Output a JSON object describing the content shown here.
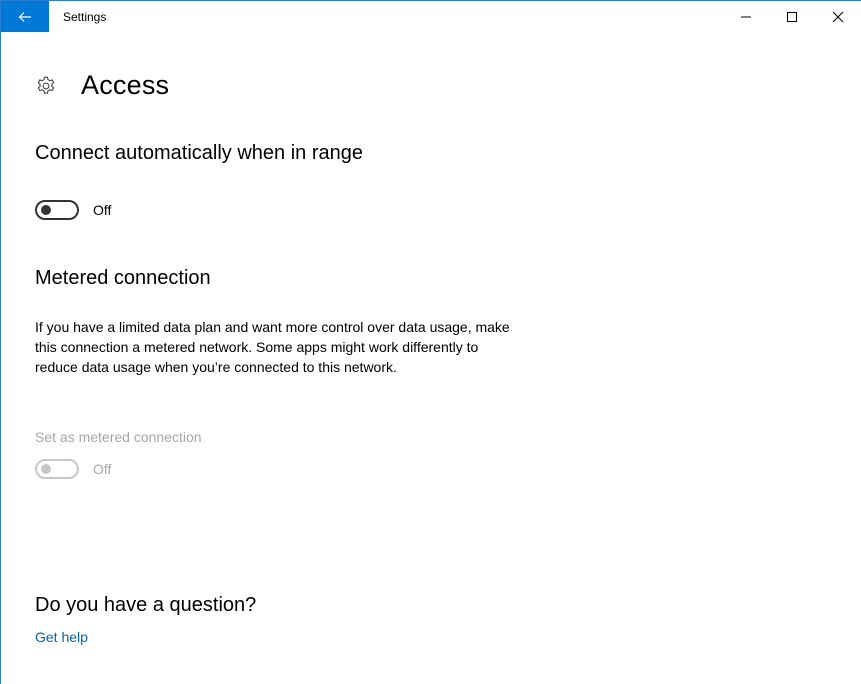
{
  "window": {
    "app_title": "Settings",
    "accent_color": "#0078d7",
    "controls": {
      "minimize_icon": "minimize-icon",
      "maximize_icon": "maximize-icon",
      "close_icon": "close-icon"
    }
  },
  "page": {
    "title": "Access",
    "icon": "gear-icon"
  },
  "connect_auto": {
    "heading": "Connect automatically when in range",
    "toggle_state": "Off",
    "toggle_on": false
  },
  "metered": {
    "heading": "Metered connection",
    "description": "If you have a limited data plan and want more control over data usage, make this connection a metered network. Some apps might work differently to reduce data usage when you’re connected to this network.",
    "setting_label": "Set as metered connection",
    "toggle_state": "Off",
    "toggle_on": false,
    "enabled": false
  },
  "help": {
    "heading": "Do you have a question?",
    "link_label": "Get help",
    "link_color": "#0063b1"
  }
}
